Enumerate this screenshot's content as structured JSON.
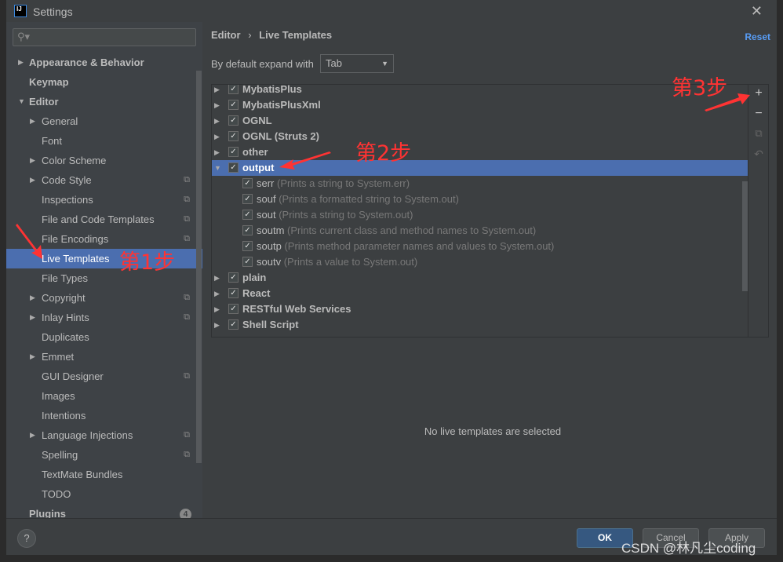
{
  "window": {
    "title": "Settings",
    "logo": "IJ",
    "close_icon": "close-icon"
  },
  "sidebar": {
    "search_placeholder": "",
    "items": [
      {
        "label": "Appearance & Behavior",
        "bold": true,
        "arrow": "▶",
        "level": 0
      },
      {
        "label": "Keymap",
        "bold": true,
        "level": 0
      },
      {
        "label": "Editor",
        "bold": true,
        "arrow": "▼",
        "level": 0
      },
      {
        "label": "General",
        "arrow": "▶",
        "level": 1
      },
      {
        "label": "Font",
        "level": 1
      },
      {
        "label": "Color Scheme",
        "arrow": "▶",
        "level": 1
      },
      {
        "label": "Code Style",
        "arrow": "▶",
        "level": 1,
        "copy": true
      },
      {
        "label": "Inspections",
        "level": 1,
        "copy": true
      },
      {
        "label": "File and Code Templates",
        "level": 1,
        "copy": true
      },
      {
        "label": "File Encodings",
        "level": 1,
        "copy": true
      },
      {
        "label": "Live Templates",
        "level": 1,
        "selected": true
      },
      {
        "label": "File Types",
        "level": 1
      },
      {
        "label": "Copyright",
        "arrow": "▶",
        "level": 1,
        "copy": true
      },
      {
        "label": "Inlay Hints",
        "arrow": "▶",
        "level": 1,
        "copy": true
      },
      {
        "label": "Duplicates",
        "level": 1
      },
      {
        "label": "Emmet",
        "arrow": "▶",
        "level": 1
      },
      {
        "label": "GUI Designer",
        "level": 1,
        "copy": true
      },
      {
        "label": "Images",
        "level": 1
      },
      {
        "label": "Intentions",
        "level": 1
      },
      {
        "label": "Language Injections",
        "arrow": "▶",
        "level": 1,
        "copy": true
      },
      {
        "label": "Spelling",
        "level": 1,
        "copy": true
      },
      {
        "label": "TextMate Bundles",
        "level": 1
      },
      {
        "label": "TODO",
        "level": 1
      },
      {
        "label": "Plugins",
        "bold": true,
        "level": 0,
        "badge": "4"
      }
    ]
  },
  "main": {
    "breadcrumb": {
      "parent": "Editor",
      "separator": "›",
      "current": "Live Templates"
    },
    "reset": "Reset",
    "expand_label": "By default expand with",
    "expand_value": "Tab",
    "tree": [
      {
        "name": "MybatisPlus",
        "group": true,
        "checked": true
      },
      {
        "name": "MybatisPlusXml",
        "group": true,
        "checked": true
      },
      {
        "name": "OGNL",
        "group": true,
        "checked": true
      },
      {
        "name": "OGNL (Struts 2)",
        "group": true,
        "checked": true
      },
      {
        "name": "other",
        "group": true,
        "checked": true
      },
      {
        "name": "output",
        "group": true,
        "checked": true,
        "expanded": true,
        "selected": true
      },
      {
        "name": "serr",
        "desc": "(Prints a string to System.err)",
        "checked": true
      },
      {
        "name": "souf",
        "desc": "(Prints a formatted string to System.out)",
        "checked": true
      },
      {
        "name": "sout",
        "desc": "(Prints a string to System.out)",
        "checked": true
      },
      {
        "name": "soutm",
        "desc": "(Prints current class and method names to System.out)",
        "checked": true
      },
      {
        "name": "soutp",
        "desc": "(Prints method parameter names and values to System.out)",
        "checked": true
      },
      {
        "name": "soutv",
        "desc": "(Prints a value to System.out)",
        "checked": true
      },
      {
        "name": "plain",
        "group": true,
        "checked": true
      },
      {
        "name": "React",
        "group": true,
        "checked": true
      },
      {
        "name": "RESTful Web Services",
        "group": true,
        "checked": true
      },
      {
        "name": "Shell Script",
        "group": true,
        "checked": true
      }
    ],
    "toolbar": {
      "add": "+",
      "remove": "−",
      "copy": "⧉",
      "restore": "↶"
    },
    "empty_text": "No live templates are selected"
  },
  "footer": {
    "help": "?",
    "ok": "OK",
    "cancel": "Cancel",
    "apply": "Apply"
  },
  "annotations": {
    "step1": "第1步",
    "step2": "第2步",
    "step3": "第3步",
    "color": "#ff3333"
  },
  "watermark": "CSDN @林凡尘coding"
}
